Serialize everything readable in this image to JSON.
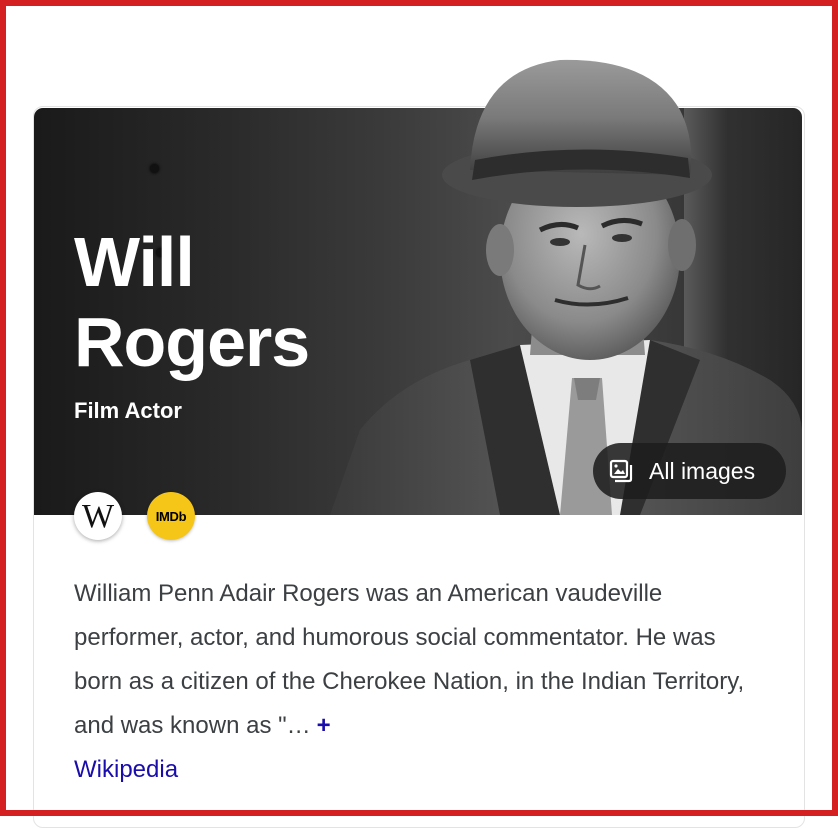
{
  "knowledge_panel": {
    "title_line1": "Will",
    "title_line2": "Rogers",
    "subtitle": "Film Actor",
    "all_images_label": "All images",
    "sources": {
      "wikipedia_glyph": "W",
      "imdb_label": "IMDb"
    },
    "description": "William Penn Adair Rogers was an American vaudeville performer, actor, and humorous social commentator. He was born as a citizen of the Cherokee Nation, in the Indian Territory, and was known as \"…",
    "more_symbol": "+",
    "source_link_label": "Wikipedia",
    "colors": {
      "frame_border": "#d42020",
      "link": "#1a0dab",
      "imdb_yellow": "#f5c518",
      "body_text": "#3c4043"
    },
    "icons": [
      "images-icon",
      "wikipedia-icon",
      "imdb-icon",
      "plus-icon"
    ]
  }
}
